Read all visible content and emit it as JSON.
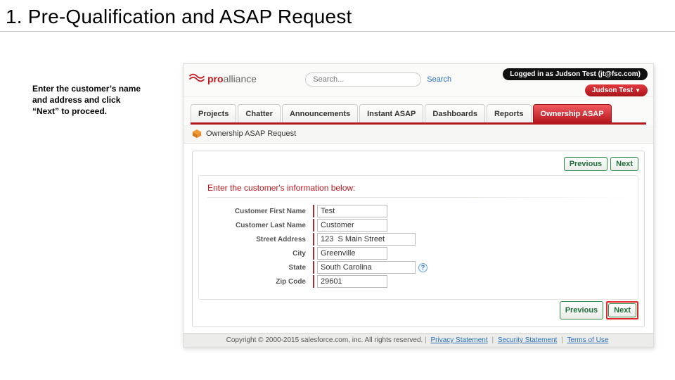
{
  "slide": {
    "title": "1. Pre-Qualification and ASAP Request",
    "instruction": "Enter the customer’s name and address and click “Next” to proceed."
  },
  "logo": {
    "part1": "pro",
    "part2": "alliance"
  },
  "search": {
    "placeholder": "Search...",
    "button": "Search"
  },
  "login_status": "Logged in as Judson Test (jt@fsc.com)",
  "user_menu": "Judson Test",
  "tabs": [
    {
      "label": "Projects",
      "active": false
    },
    {
      "label": "Chatter",
      "active": false
    },
    {
      "label": "Announcements",
      "active": false
    },
    {
      "label": "Instant ASAP",
      "active": false
    },
    {
      "label": "Dashboards",
      "active": false
    },
    {
      "label": "Reports",
      "active": false
    },
    {
      "label": "Ownership ASAP",
      "active": true
    }
  ],
  "page_header": "Ownership ASAP Request",
  "nav": {
    "previous": "Previous",
    "next": "Next"
  },
  "form": {
    "heading": "Enter the customer's information below:",
    "fields": {
      "first_name": {
        "label": "Customer First Name",
        "value": "Test"
      },
      "last_name": {
        "label": "Customer Last Name",
        "value": "Customer"
      },
      "street": {
        "label": "Street Address",
        "value": "123  S Main Street"
      },
      "city": {
        "label": "City",
        "value": "Greenville"
      },
      "state": {
        "label": "State",
        "value": "South Carolina"
      },
      "zip": {
        "label": "Zip Code",
        "value": "29601"
      }
    }
  },
  "footer": {
    "copyright": "Copyright © 2000-2015 salesforce.com, inc. All rights reserved.",
    "links": [
      "Privacy Statement",
      "Security Statement",
      "Terms of Use"
    ]
  }
}
